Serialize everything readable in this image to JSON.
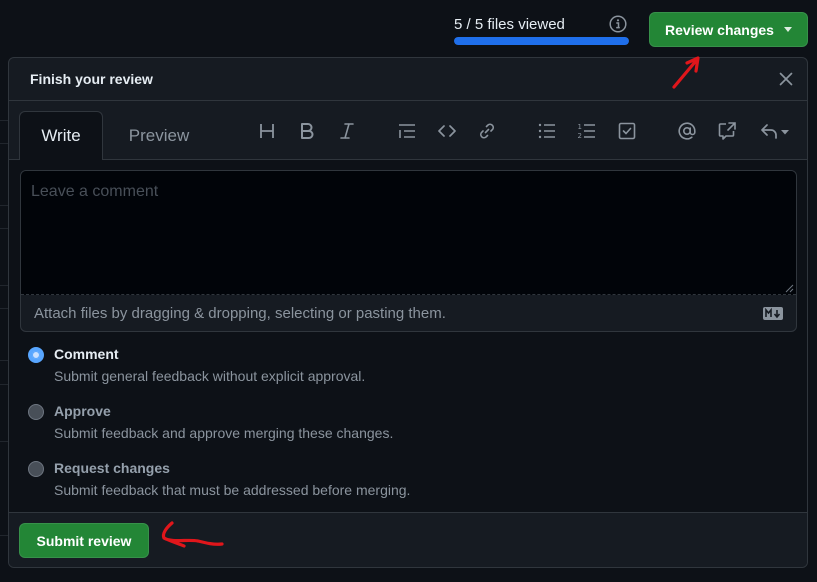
{
  "top_bar": {
    "files_viewed_text": "5 / 5 files viewed",
    "files_viewed": 5,
    "files_total": 5,
    "progress_fraction": 1.0,
    "info_icon": "info-icon",
    "review_changes_label": "Review changes"
  },
  "dialog": {
    "title": "Finish your review",
    "close_icon": "close-icon",
    "tabs": [
      {
        "label": "Write",
        "active": true
      },
      {
        "label": "Preview",
        "active": false
      }
    ],
    "toolbar": [
      {
        "name": "heading",
        "icon": "heading-icon"
      },
      {
        "name": "bold",
        "icon": "bold-icon"
      },
      {
        "name": "italic",
        "icon": "italic-icon"
      },
      {
        "name": "quote",
        "icon": "quote-icon"
      },
      {
        "name": "code",
        "icon": "code-icon"
      },
      {
        "name": "link",
        "icon": "link-icon"
      },
      {
        "name": "unordered-list",
        "icon": "unordered-list-icon"
      },
      {
        "name": "ordered-list",
        "icon": "ordered-list-icon"
      },
      {
        "name": "task-list",
        "icon": "task-list-icon"
      },
      {
        "name": "mention",
        "icon": "mention-icon"
      },
      {
        "name": "cross-reference",
        "icon": "cross-reference-icon"
      },
      {
        "name": "saved-replies",
        "icon": "reply-icon"
      }
    ],
    "comment": {
      "value": "",
      "placeholder": "Leave a comment",
      "attach_text": "Attach files by dragging & dropping, selecting or pasting them.",
      "markdown_icon": "markdown-icon"
    },
    "options": [
      {
        "label": "Comment",
        "description": "Submit general feedback without explicit approval.",
        "checked": true
      },
      {
        "label": "Approve",
        "description": "Submit feedback and approve merging these changes.",
        "checked": false
      },
      {
        "label": "Request changes",
        "description": "Submit feedback that must be addressed before merging.",
        "checked": false
      }
    ],
    "submit_label": "Submit review"
  },
  "colors": {
    "accent_green": "#238636",
    "progress_blue": "#1f6feb",
    "radio_blue": "#58a6ff",
    "annotation_red": "#e0161b"
  }
}
